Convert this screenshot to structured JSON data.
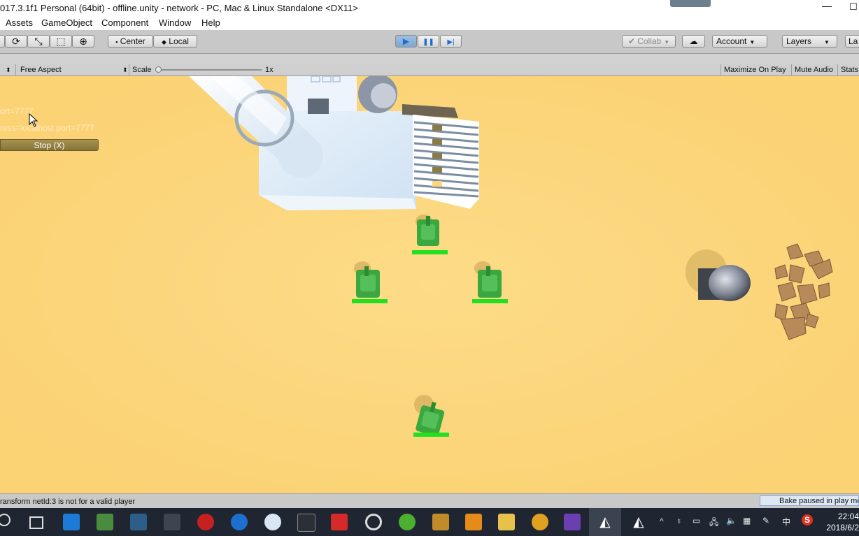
{
  "window": {
    "title": "017.3.1f1 Personal (64bit) - offline.unity - network - PC, Mac & Linux Standalone <DX11>",
    "minimize_glyph": "—",
    "restore_glyph": "☐"
  },
  "menu": {
    "items": [
      "Assets",
      "GameObject",
      "Component",
      "Window",
      "Help"
    ]
  },
  "toolbar": {
    "tools": [
      {
        "name": "rotate-tool-icon",
        "glyph": "⟳"
      },
      {
        "name": "scale-tool-icon",
        "glyph": "⤡"
      },
      {
        "name": "rect-tool-icon",
        "glyph": "⬚"
      },
      {
        "name": "transform-tool-icon",
        "glyph": "⊕"
      }
    ],
    "pivot_label": "Center",
    "handle_label": "Local",
    "play_glyph": "▶",
    "pause_glyph": "❚❚",
    "step_glyph": "▶|",
    "collab_label": "Collab",
    "cloud_glyph": "☁",
    "account_label": "Account",
    "layers_label": "Layers",
    "layout_label": "La"
  },
  "gamebar": {
    "aspect_label": "Free Aspect",
    "scale_label": "Scale",
    "scale_value": "1x",
    "maximize_label": "Maximize On Play",
    "mute_label": "Mute Audio",
    "stats_label": "Stats"
  },
  "game": {
    "overlay_line1": "ort=7777",
    "overlay_line2": "ress=localhost port=7777",
    "stop_label": "Stop (X)"
  },
  "status": {
    "message": "ransform netId:3 is not for a valid player",
    "bake_label": "Bake paused in play mode"
  },
  "taskbar": {
    "apps": [
      "search-icon",
      "task-view-icon",
      "store-icon",
      "app-icon",
      "sql-icon",
      "terminal-icon",
      "video-icon",
      "edge-icon",
      "paint-icon",
      "cmd-icon",
      "netease-music-icon",
      "steam-icon",
      "sync-icon",
      "sublime-icon",
      "sublime-text-icon",
      "explorer-icon",
      "chrome-icon",
      "visual-studio-icon",
      "unity-icon",
      "unity-icon-2"
    ],
    "tray_glyphs": [
      "^",
      "♁",
      "▭",
      "🖧",
      "🔈",
      "▦",
      "✎",
      "中",
      "S"
    ],
    "time": "22:04",
    "date": "2018/6/2"
  },
  "colors": {
    "ground": "#fcd67c",
    "tank_green": "#3aa83f",
    "health_bar": "#20e020",
    "stop_button": "#8f7d41",
    "taskbar": "#1f2632"
  }
}
